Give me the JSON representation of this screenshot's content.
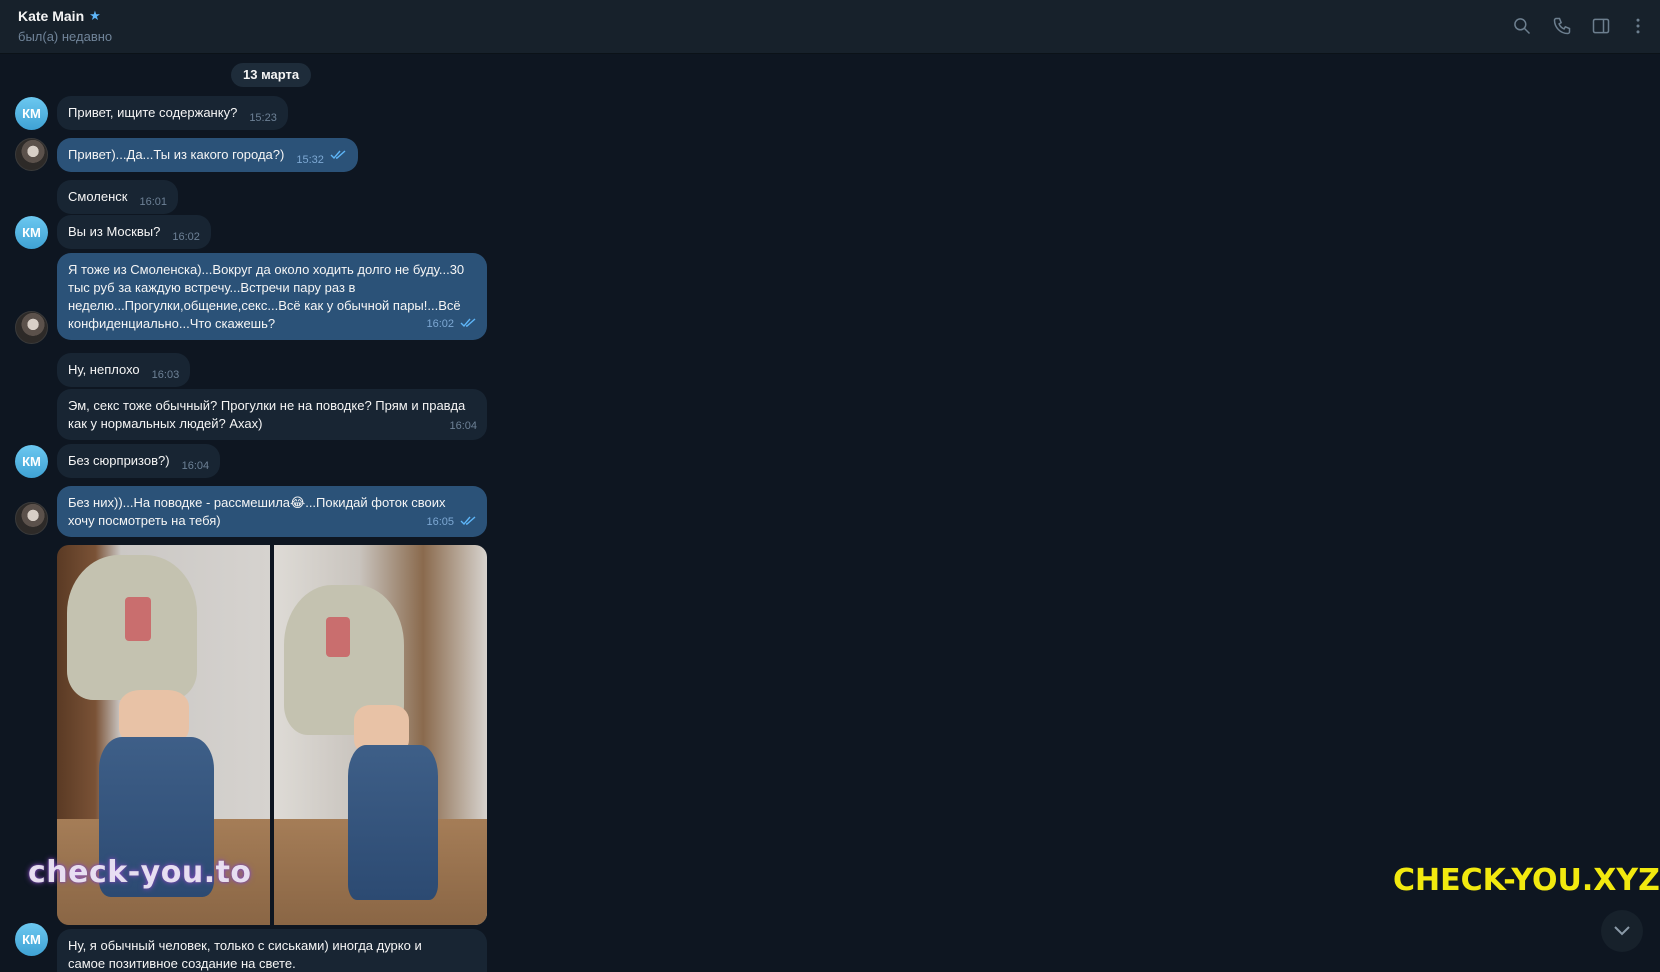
{
  "header": {
    "contact_name": "Kate Main",
    "status": "был(а) недавно",
    "icons": [
      "search-icon",
      "phone-icon",
      "sidebar-toggle-icon",
      "more-vertical-icon"
    ]
  },
  "date_separator": "13 марта",
  "avatar_initials": "КМ",
  "messages": [
    {
      "text": "Привет, ищите содержанку?",
      "time": "15:23",
      "direction": "in"
    },
    {
      "text": "Привет)...Да...Ты из какого города?)",
      "time": "15:32",
      "direction": "out",
      "read": true
    },
    {
      "text": "Смоленск",
      "time": "16:01",
      "direction": "in"
    },
    {
      "text": "Вы из Москвы?",
      "time": "16:02",
      "direction": "in"
    },
    {
      "line1": "Я тоже из Смоленска)...Вокруг да около ходить долго не буду...30",
      "line2": "тыс руб за каждую встречу...Встречи пару раз в",
      "line3": "неделю...Прогулки,общение,секс...Всё как у обычной пары!...Всё",
      "line4": "конфиденциально...Что скажешь?",
      "time": "16:02",
      "direction": "out",
      "read": true
    },
    {
      "text": "Ну, неплохо",
      "time": "16:03",
      "direction": "in"
    },
    {
      "line1": "Эм, секс тоже обычный? Прогулки не на поводке? Прям и правда",
      "line2": "как у нормальных людей? Ахах)",
      "time": "16:04",
      "direction": "in"
    },
    {
      "text": "Без сюрпризов?)",
      "time": "16:04",
      "direction": "in"
    },
    {
      "line1": "Без них))...На поводке - рассмешила😂...Покидай фоток своих",
      "line2": "хочу посмотреть на тебя)",
      "time": "16:05",
      "direction": "out",
      "read": true
    },
    {
      "line1": "Ну, я обычный человек, только с сиськами) иногда дурко и",
      "line2": "самое позитивное создание на свете.",
      "direction": "in"
    }
  ],
  "watermarks": {
    "left": "check-you.to",
    "right": "CHECK-YOU.XYZ"
  },
  "colors": {
    "background": "#0e1621",
    "header": "#17212b",
    "incoming_bubble": "#182533",
    "outgoing_bubble": "#2b5278",
    "accent": "#5eb5f7",
    "watermark_yellow": "#f2e90f"
  }
}
